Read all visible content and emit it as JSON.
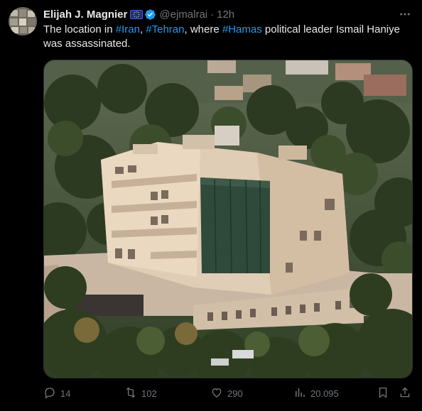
{
  "author": {
    "name": "Elijah J. Magnier",
    "handle": "@ejmalrai",
    "separator": "·",
    "time": "12h",
    "flag_icon": "eu-flag-icon",
    "verified_icon": "verified-badge-icon"
  },
  "tweet": {
    "segments": [
      {
        "text": "The location in ",
        "hashtag": false
      },
      {
        "text": "#Iran",
        "hashtag": true
      },
      {
        "text": ", ",
        "hashtag": false
      },
      {
        "text": "#Tehran",
        "hashtag": true
      },
      {
        "text": ", where ",
        "hashtag": false
      },
      {
        "text": "#Hamas",
        "hashtag": true
      },
      {
        "text": " political leader Ismail Haniye was assassinated.",
        "hashtag": false
      }
    ]
  },
  "actions": {
    "replies": "14",
    "reposts": "102",
    "likes": "290",
    "views": "20.095"
  },
  "colors": {
    "background": "#000000",
    "text": "#e7e9ea",
    "muted": "#71767b",
    "accent": "#1d9bf0"
  }
}
